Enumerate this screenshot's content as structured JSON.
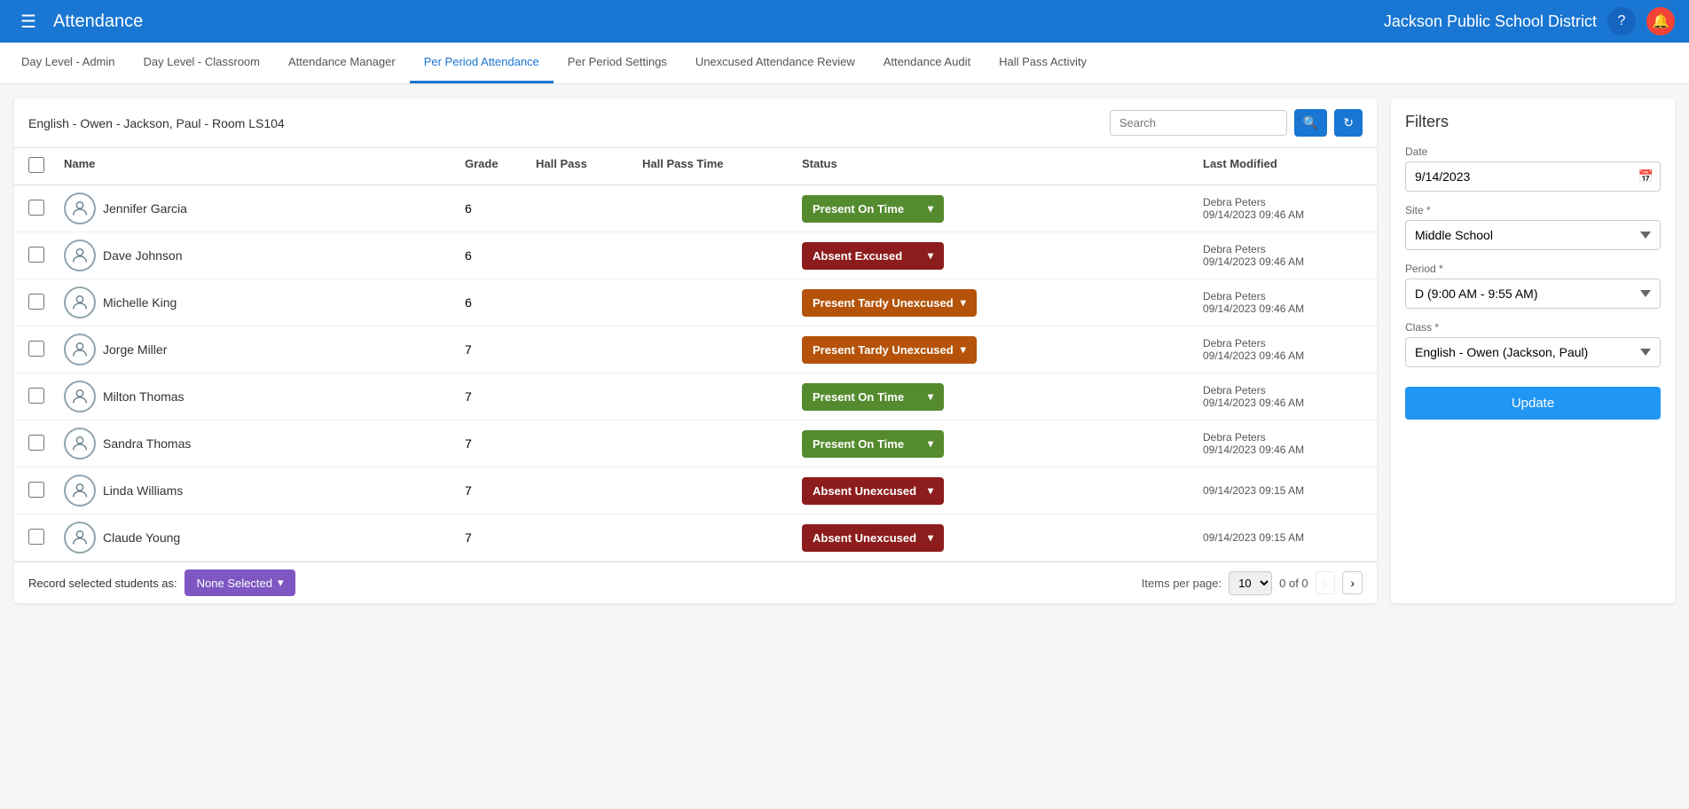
{
  "app": {
    "title": "Attendance",
    "school_district": "Jackson Public School District"
  },
  "tabs": [
    {
      "label": "Day Level - Admin",
      "active": false
    },
    {
      "label": "Day Level - Classroom",
      "active": false
    },
    {
      "label": "Attendance Manager",
      "active": false
    },
    {
      "label": "Per Period Attendance",
      "active": true
    },
    {
      "label": "Per Period Settings",
      "active": false
    },
    {
      "label": "Unexcused Attendance Review",
      "active": false
    },
    {
      "label": "Attendance Audit",
      "active": false
    },
    {
      "label": "Hall Pass Activity",
      "active": false
    }
  ],
  "search_bar": {
    "class_label": "English - Owen - Jackson, Paul - Room LS104",
    "search_placeholder": "Search"
  },
  "table": {
    "headers": [
      "",
      "Name",
      "Grade",
      "Hall Pass",
      "Hall Pass Time",
      "Status",
      "Last Modified"
    ],
    "rows": [
      {
        "name": "Jennifer Garcia",
        "grade": "6",
        "hall_pass": "",
        "hall_pass_time": "",
        "status": "Present On Time",
        "status_class": "status-present",
        "last_modified_by": "Debra Peters",
        "last_modified_date": "09/14/2023 09:46 AM"
      },
      {
        "name": "Dave Johnson",
        "grade": "6",
        "hall_pass": "",
        "hall_pass_time": "",
        "status": "Absent Excused",
        "status_class": "status-absent-excused",
        "last_modified_by": "Debra Peters",
        "last_modified_date": "09/14/2023 09:46 AM"
      },
      {
        "name": "Michelle King",
        "grade": "6",
        "hall_pass": "",
        "hall_pass_time": "",
        "status": "Present Tardy Unexcused",
        "status_class": "status-tardy",
        "last_modified_by": "Debra Peters",
        "last_modified_date": "09/14/2023 09:46 AM"
      },
      {
        "name": "Jorge Miller",
        "grade": "7",
        "hall_pass": "",
        "hall_pass_time": "",
        "status": "Present Tardy Unexcused",
        "status_class": "status-tardy",
        "last_modified_by": "Debra Peters",
        "last_modified_date": "09/14/2023 09:46 AM"
      },
      {
        "name": "Milton Thomas",
        "grade": "7",
        "hall_pass": "",
        "hall_pass_time": "",
        "status": "Present On Time",
        "status_class": "status-present",
        "last_modified_by": "Debra Peters",
        "last_modified_date": "09/14/2023 09:46 AM"
      },
      {
        "name": "Sandra Thomas",
        "grade": "7",
        "hall_pass": "",
        "hall_pass_time": "",
        "status": "Present On Time",
        "status_class": "status-present",
        "last_modified_by": "Debra Peters",
        "last_modified_date": "09/14/2023 09:46 AM"
      },
      {
        "name": "Linda Williams",
        "grade": "7",
        "hall_pass": "",
        "hall_pass_time": "",
        "status": "Absent Unexcused",
        "status_class": "status-absent-unexcused",
        "last_modified_by": "",
        "last_modified_date": "09/14/2023 09:15 AM"
      },
      {
        "name": "Claude Young",
        "grade": "7",
        "hall_pass": "",
        "hall_pass_time": "",
        "status": "Absent Unexcused",
        "status_class": "status-absent-unexcused",
        "last_modified_by": "",
        "last_modified_date": "09/14/2023 09:15 AM"
      }
    ]
  },
  "filters": {
    "title": "Filters",
    "date_label": "Date",
    "date_value": "9/14/2023",
    "site_label": "Site *",
    "site_value": "Middle School",
    "period_label": "Period *",
    "period_value": "D (9:00 AM - 9:55 AM)",
    "class_label": "Class *",
    "class_value": "English - Owen (Jackson, Paul)",
    "update_btn": "Update"
  },
  "bottom_bar": {
    "record_label": "Record selected students as:",
    "none_selected": "None Selected",
    "items_per_page_label": "Items per page:",
    "items_per_page": "10",
    "page_info": "0 of 0"
  },
  "icons": {
    "hamburger": "☰",
    "help": "?",
    "notification": "🔔",
    "search": "🔍",
    "refresh": "↻",
    "dropdown": "▾",
    "calendar": "📅",
    "chevron_left": "‹",
    "chevron_right": "›",
    "avatar": "👤"
  }
}
